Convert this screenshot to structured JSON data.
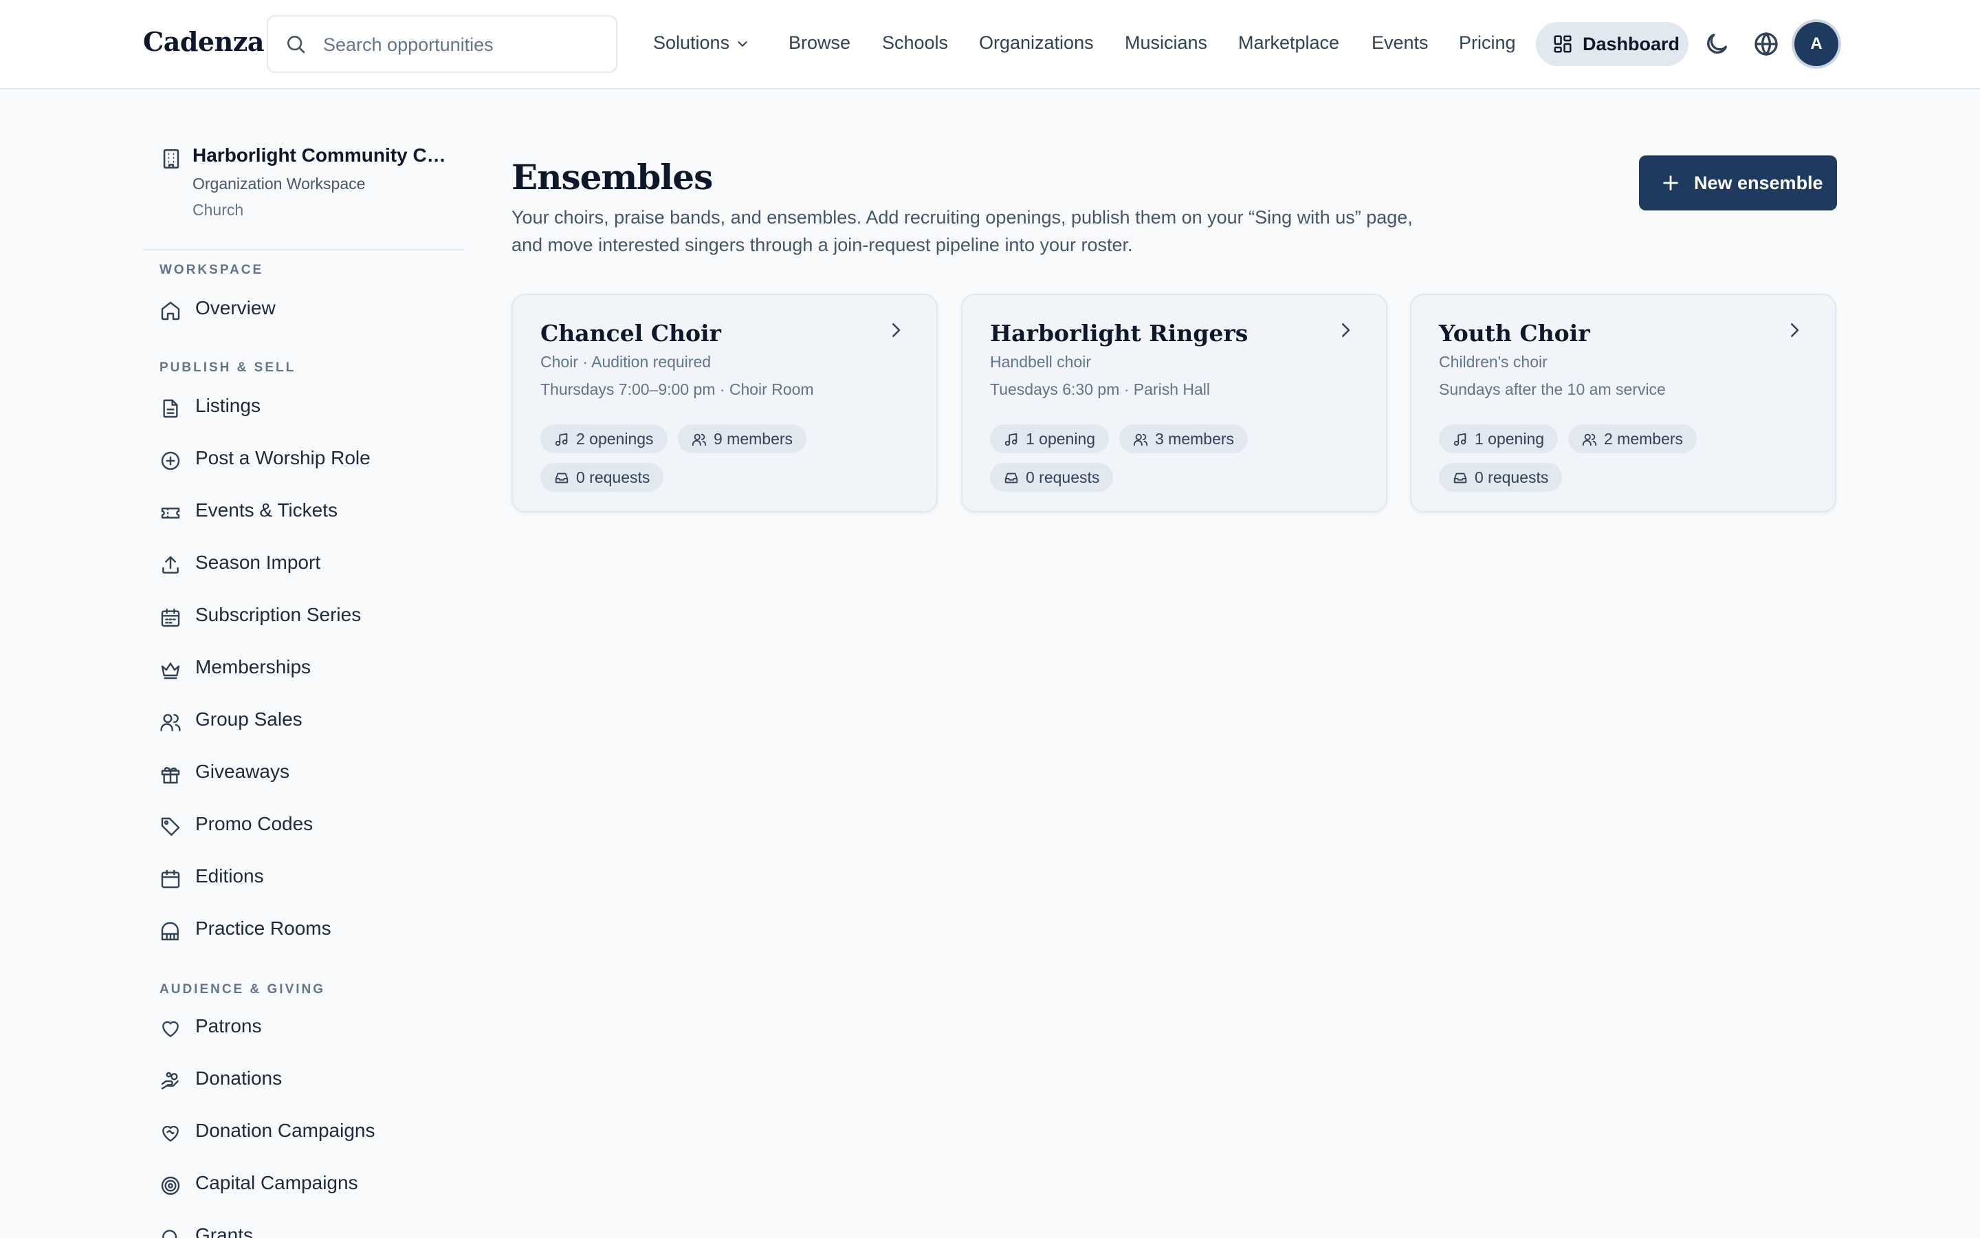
{
  "app": {
    "brand": "Cadenza"
  },
  "search": {
    "placeholder": "Search opportunities"
  },
  "nav": {
    "solutions": "Solutions",
    "browse": "Browse",
    "schools": "Schools",
    "organizations": "Organizations",
    "musicians": "Musicians",
    "marketplace": "Marketplace",
    "events": "Events",
    "pricing": "Pricing",
    "dashboard": "Dashboard"
  },
  "user": {
    "initial": "A"
  },
  "org": {
    "name": "Harborlight Community Church",
    "subtitle": "Organization Workspace",
    "type": "Church"
  },
  "sidebar": {
    "workspace_heading": "WORKSPACE",
    "overview": "Overview",
    "publish_heading": "PUBLISH & SELL",
    "publish_items": [
      {
        "label": "Listings",
        "icon": "document-icon"
      },
      {
        "label": "Post a Worship Role",
        "icon": "plus-circle-icon"
      },
      {
        "label": "Events & Tickets",
        "icon": "ticket-icon"
      },
      {
        "label": "Season Import",
        "icon": "upload-icon"
      },
      {
        "label": "Subscription Series",
        "icon": "calendar-grid-icon"
      },
      {
        "label": "Memberships",
        "icon": "crown-icon"
      },
      {
        "label": "Group Sales",
        "icon": "users-icon"
      },
      {
        "label": "Giveaways",
        "icon": "gift-icon"
      },
      {
        "label": "Promo Codes",
        "icon": "tag-icon"
      },
      {
        "label": "Editions",
        "icon": "calendar-icon"
      },
      {
        "label": "Practice Rooms",
        "icon": "piano-icon"
      }
    ],
    "audience_heading": "AUDIENCE & GIVING",
    "audience_items": [
      {
        "label": "Patrons",
        "icon": "heart-icon"
      },
      {
        "label": "Donations",
        "icon": "hand-coins-icon"
      },
      {
        "label": "Donation Campaigns",
        "icon": "heart-handshake-icon"
      },
      {
        "label": "Capital Campaigns",
        "icon": "target-icon"
      },
      {
        "label": "Grants",
        "icon": "search-icon"
      }
    ]
  },
  "main": {
    "title": "Ensembles",
    "description": "Your choirs, praise bands, and ensembles. Add recruiting openings, publish them on your “Sing with us” page, and move interested singers through a join-request pipeline into your roster.",
    "new_button": "New ensemble"
  },
  "ensembles": [
    {
      "name": "Chancel Choir",
      "type": "Choir · Audition required",
      "schedule": "Thursdays 7:00–9:00 pm · Choir Room",
      "openings": "2 openings",
      "members": "9 members",
      "requests": "0 requests"
    },
    {
      "name": "Harborlight Ringers",
      "type": "Handbell choir",
      "schedule": "Tuesdays 6:30 pm · Parish Hall",
      "openings": "1 opening",
      "members": "3 members",
      "requests": "0 requests"
    },
    {
      "name": "Youth Choir",
      "type": "Children's choir",
      "schedule": "Sundays after the 10 am service",
      "openings": "1 opening",
      "members": "2 members",
      "requests": "0 requests"
    }
  ],
  "colors": {
    "primary": "#1e3a5f",
    "background": "#f8fafc",
    "card": "#f1f5f9",
    "chip": "#e2e8f0"
  }
}
